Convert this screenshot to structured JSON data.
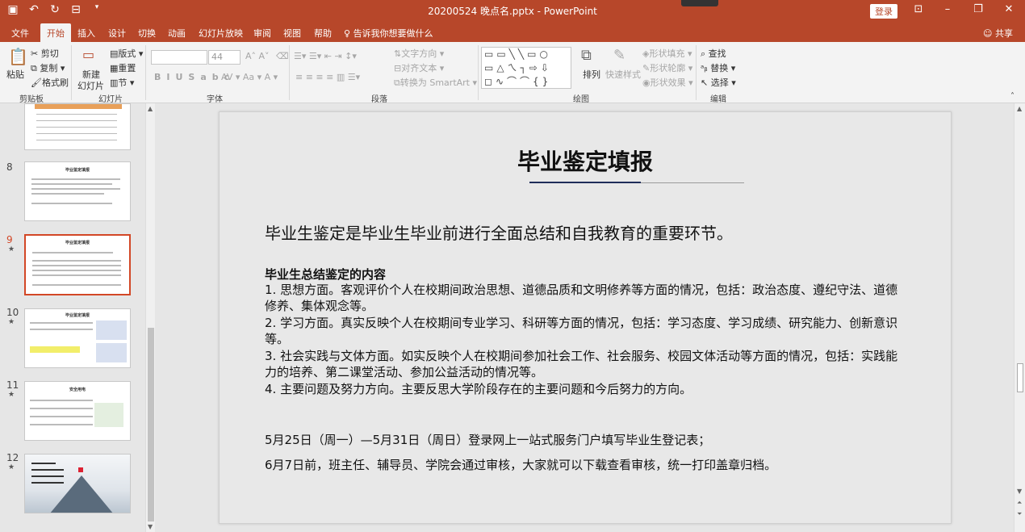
{
  "window": {
    "title": "20200524 晚点名.pptx - PowerPoint",
    "login": "登录"
  },
  "tabs": [
    "文件",
    "开始",
    "插入",
    "设计",
    "切换",
    "动画",
    "幻灯片放映",
    "审阅",
    "视图",
    "帮助"
  ],
  "tell_me": "告诉我你想要做什么",
  "share": "共享",
  "ribbon": {
    "clipboard": {
      "paste": "粘贴",
      "cut": "剪切",
      "copy": "复制",
      "format_painter": "格式刷",
      "label": "剪贴板"
    },
    "slides": {
      "new_slide_1": "新建",
      "new_slide_2": "幻灯片",
      "layout": "版式",
      "reset": "重置",
      "section": "节",
      "label": "幻灯片"
    },
    "font": {
      "size": "44",
      "label": "字体"
    },
    "paragraph": {
      "text_direction": "文字方向",
      "align_text": "对齐文本",
      "smartart": "转换为 SmartArt",
      "label": "段落"
    },
    "drawing": {
      "arrange": "排列",
      "quick_styles": "快速样式",
      "shape_fill": "形状填充",
      "shape_outline": "形状轮廓",
      "shape_effects": "形状效果",
      "label": "绘图"
    },
    "editing": {
      "find": "查找",
      "replace": "替换",
      "select": "选择",
      "label": "编辑"
    }
  },
  "thumbnails": [
    {
      "num": "8",
      "title": "毕业鉴定填报"
    },
    {
      "num": "9",
      "title": "毕业鉴定填报"
    },
    {
      "num": "10",
      "title": "毕业鉴定填报"
    },
    {
      "num": "11",
      "title": "安全用电"
    },
    {
      "num": "12",
      "title": ""
    }
  ],
  "slide": {
    "title": "毕业鉴定填报",
    "lead": "毕业生鉴定是毕业生毕业前进行全面总结和自我教育的重要环节。",
    "section_heading": "毕业生总结鉴定的内容",
    "items": [
      "1. 思想方面。客观评价个人在校期间政治思想、道德品质和文明修养等方面的情况，包括：政治态度、遵纪守法、道德修养、集体观念等。",
      "2. 学习方面。真实反映个人在校期间专业学习、科研等方面的情况，包括：学习态度、学习成绩、研究能力、创新意识等。",
      "3. 社会实践与文体方面。如实反映个人在校期间参加社会工作、社会服务、校园文体活动等方面的情况，包括：实践能力的培养、第二课堂活动、参加公益活动的情况等。",
      "4. 主要问题及努力方向。主要反思大学阶段存在的主要问题和今后努力的方向。"
    ],
    "note1": "5月25日（周一）—5月31日（周日）登录网上一站式服务门户填写毕业生登记表；",
    "note2": "6月7日前，班主任、辅导员、学院会通过审核，大家就可以下载查看审核，统一打印盖章归档。"
  }
}
